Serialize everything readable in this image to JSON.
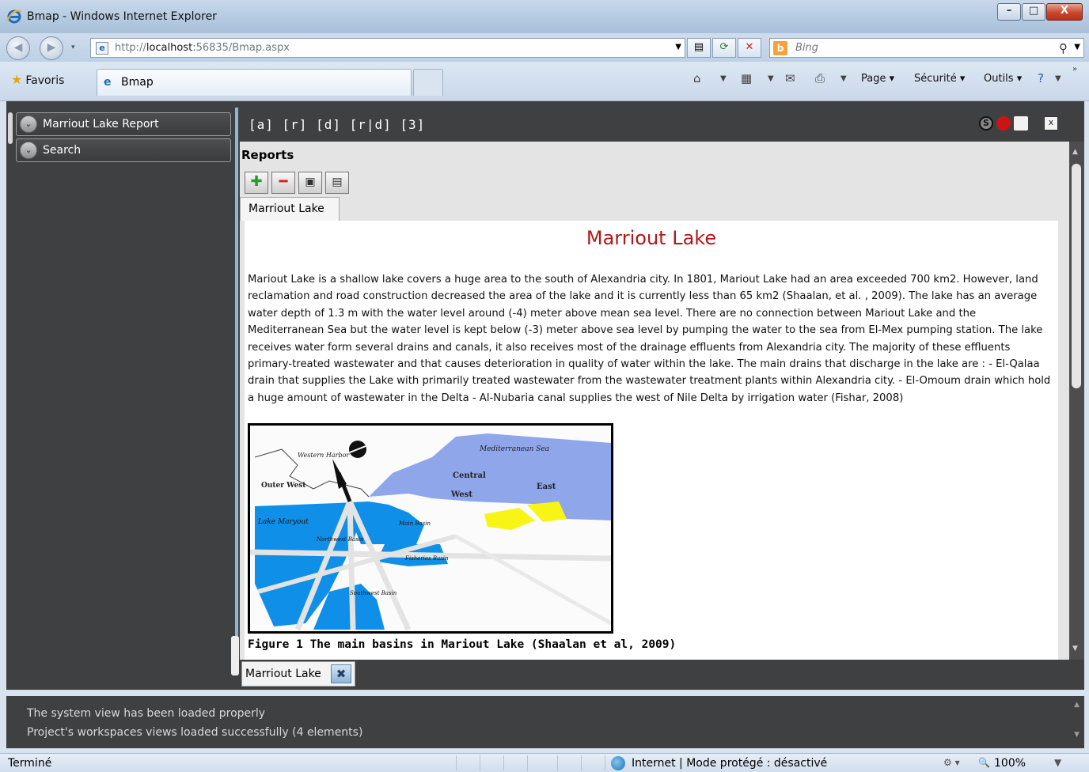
{
  "window": {
    "title": "Bmap - Windows Internet Explorer",
    "minimize_glyph": "–",
    "maximize_glyph": "□",
    "close_glyph": "X"
  },
  "addressbar": {
    "url_prefix": "http://",
    "url_host": "localhost",
    "url_rest": ":56835/Bmap.aspx",
    "search_placeholder": "Bing",
    "search_logo": "b"
  },
  "favbar": {
    "favorites_label": "Favoris",
    "tab_title": "Bmap",
    "commands": {
      "page": "Page ▾",
      "security": "Sécurité ▾",
      "tools": "Outils ▾"
    }
  },
  "sidebar": {
    "items": [
      {
        "label": "Marriout Lake Report"
      },
      {
        "label": "Search"
      }
    ]
  },
  "workspace": {
    "modes": "[a] [r] [d] [r|d] [3]",
    "ctrl_s": "S",
    "ctrl_x": "x"
  },
  "reports": {
    "title": "Reports",
    "doc_tab": "Marriout Lake",
    "heading": "Marriout Lake",
    "body": "Mariout Lake is a shallow lake covers a huge area to the south of Alexandria city. In 1801, Mariout Lake had an area exceeded 700 km2. However, land reclamation and road construction decreased the area of the lake and it is currently less than 65 km2 (Shaalan, et al. , 2009). The lake has an average water depth of 1.3 m with the water level around (-4) meter above mean sea level. There are no connection between Mariout Lake and the Mediterranean Sea but the water level is kept below (-3) meter above sea level by pumping the water to the sea from El-Mex pumping station. The lake receives water form several drains and canals, it also receives most of the drainage effluents from Alexandria city. The majority of these effluents primary-treated wastewater and that causes deterioration in quality of water within the lake. The main drains that discharge in the lake are : - El-Qalaa drain that supplies the Lake with primarily treated wastewater from the wastewater treatment plants within Alexandria city. - El-Omoum drain which hold a huge amount of wastewater in the Delta - Al-Nubaria canal supplies the west of Nile Delta by irrigation water (Fishar, 2008)",
    "caption": "Figure 1 The main basins in Mariout Lake (Shaalan et al, 2009)",
    "map_labels": {
      "western_harbor": "Western Harbor",
      "outer_west": "Outer West",
      "mediterranean": "Mediterranean Sea",
      "central": "Central",
      "west": "West",
      "east": "East",
      "lake_maryout": "Lake Maryout",
      "northwest_basin": "Northwest Basin",
      "main_basin": "Main Basin",
      "fisheries_basin": "Fisheries Basin",
      "southwest_basin": "Southwest Basin"
    }
  },
  "bottom_tab": {
    "label": "Marriout Lake"
  },
  "log": {
    "lines": [
      "The system view has been loaded properly",
      "Project's workspaces views loaded successfully (4 elements)"
    ]
  },
  "statusbar": {
    "status": "Terminé",
    "zone": "Internet | Mode protégé : désactivé",
    "zoom": "100%"
  },
  "colors": {
    "app_bg": "#3f4042",
    "heading_red": "#b11818",
    "splitter": "#8fb6d2",
    "water_blue": "#0f8fe8",
    "sea_blue": "#8fa6ea",
    "yellow": "#f7f416"
  }
}
